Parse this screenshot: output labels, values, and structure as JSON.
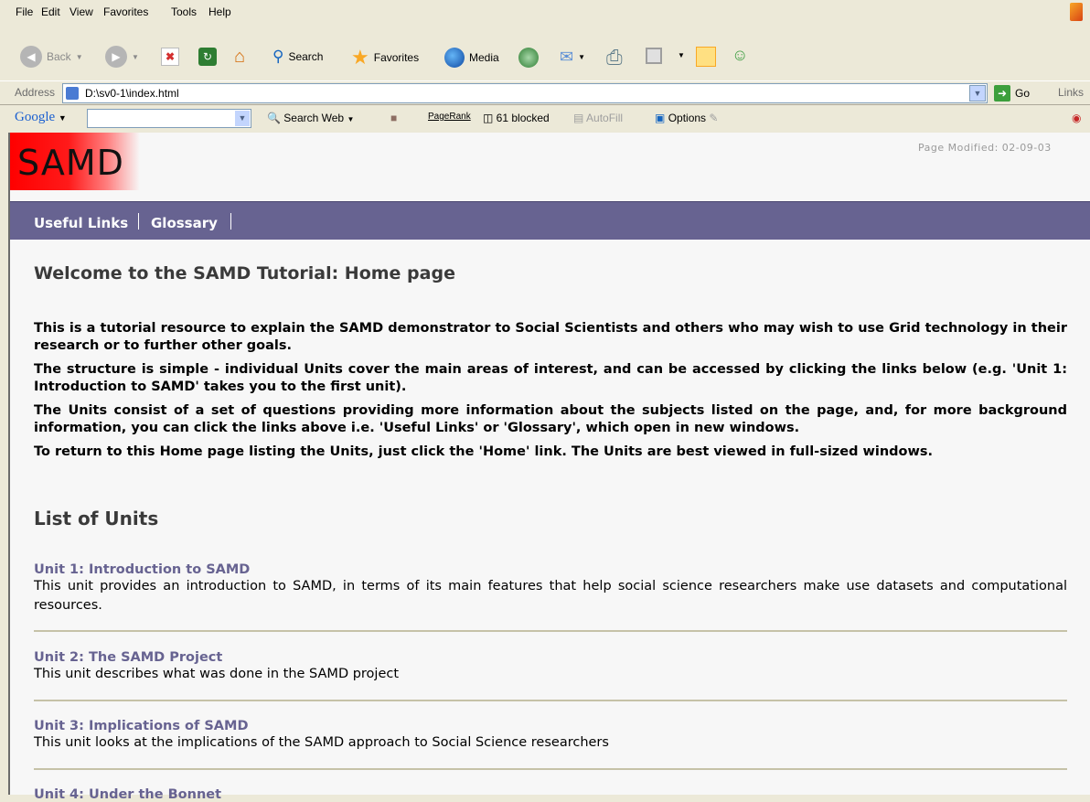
{
  "menu": [
    "File",
    "Edit",
    "View",
    "Favorites",
    "Tools",
    "Help"
  ],
  "toolbar": {
    "back": "Back",
    "search": "Search",
    "favorites": "Favorites",
    "media": "Media"
  },
  "address": {
    "label": "Address",
    "url": "D:\\sv0-1\\index.html",
    "go": "Go",
    "links": "Links"
  },
  "google": {
    "logo": "Google",
    "search_web": "Search Web",
    "pagerank": "PageRank",
    "blocked": "61 blocked",
    "autofill": "AutoFill",
    "options": "Options"
  },
  "page": {
    "logo": "SAMD",
    "modified": "Page Modified: 02-09-03",
    "nav": [
      "Useful Links",
      "Glossary"
    ],
    "title": "Welcome to the SAMD Tutorial: Home page",
    "intro": [
      "This is a tutorial resource to explain the SAMD demonstrator to Social Scientists and others who may wish to use Grid technology in their research or to further other goals.",
      "The structure is simple - individual Units cover the main areas of interest, and can be accessed by clicking the links below (e.g. 'Unit 1: Introduction to SAMD' takes you to the first unit).",
      "The Units consist of a set of questions providing more information about the subjects listed on the page, and, for more background information, you can click the links above i.e. 'Useful Links' or 'Glossary', which open in new windows.",
      "To return to this Home page listing the Units, just click the 'Home' link. The Units are best viewed in full-sized windows."
    ],
    "units_heading": "List of Units",
    "units": [
      {
        "title": "Unit 1: Introduction to SAMD",
        "desc": "This unit provides an introduction to SAMD, in terms of its main features that help social science researchers make use datasets and computational resources."
      },
      {
        "title": "Unit 2: The SAMD Project",
        "desc": "This unit describes what was done in the SAMD project"
      },
      {
        "title": "Unit 3: Implications of SAMD",
        "desc": "This unit looks at the implications of the SAMD approach to Social Science researchers"
      },
      {
        "title": "Unit 4: Under the Bonnet",
        "desc": ""
      }
    ]
  }
}
